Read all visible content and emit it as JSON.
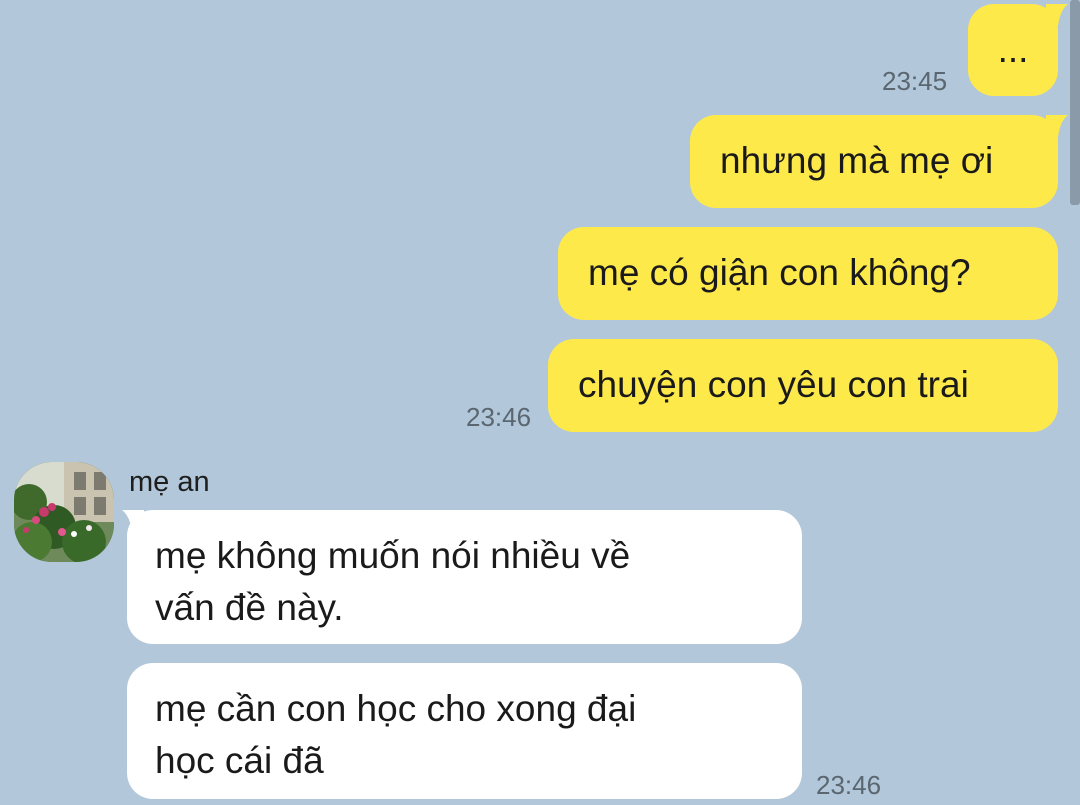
{
  "conversation": {
    "outgoing": [
      {
        "text": "...",
        "time": "23:45"
      },
      {
        "text": "nhưng mà mẹ ơi",
        "time": ""
      },
      {
        "text": "mẹ có giận con không?",
        "time": ""
      },
      {
        "text": "chuyện con yêu con trai",
        "time": "23:46"
      }
    ],
    "incoming": {
      "sender": "mẹ an",
      "messages": [
        {
          "text": "mẹ không muốn nói nhiều về\nvấn đề này.",
          "time": ""
        },
        {
          "text": "mẹ cần con học cho xong đại\nhọc cái đã",
          "time": "23:46"
        }
      ]
    }
  },
  "colors": {
    "background": "#b2c7d9",
    "outgoing_bubble": "#fee94b",
    "incoming_bubble": "#ffffff",
    "timestamp": "#5a6670"
  },
  "icons": {
    "avatar": "profile-photo-flowers"
  }
}
